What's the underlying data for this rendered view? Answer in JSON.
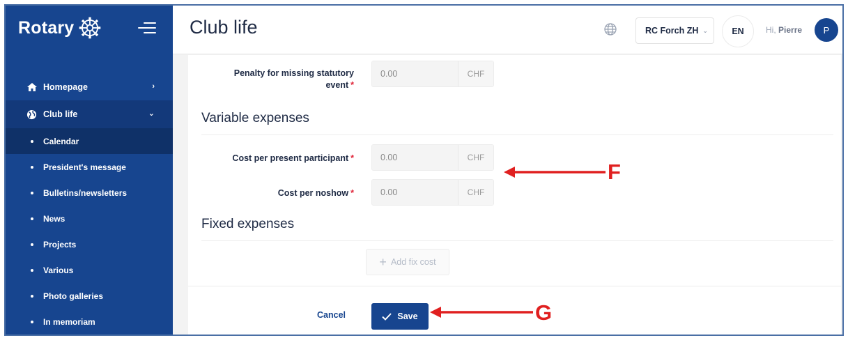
{
  "brand": {
    "name": "Rotary"
  },
  "sidebar": {
    "items": [
      {
        "label": "Homepage",
        "icon": "home-icon"
      },
      {
        "label": "Club life",
        "icon": "globe-icon"
      }
    ],
    "subitems": [
      {
        "label": "Calendar",
        "active": true
      },
      {
        "label": "President's message"
      },
      {
        "label": "Bulletins/newsletters"
      },
      {
        "label": "News"
      },
      {
        "label": "Projects"
      },
      {
        "label": "Various"
      },
      {
        "label": "Photo galleries"
      },
      {
        "label": "In memoriam"
      }
    ]
  },
  "header": {
    "title": "Club life",
    "club_selected": "RC Forch ZH",
    "language": "EN",
    "greeting_prefix": "Hi,",
    "user_name": "Pierre",
    "avatar_initial": "P"
  },
  "form": {
    "penalty": {
      "label_line1": "Penalty for missing statutory",
      "label_line2": "event",
      "value": "0.00",
      "unit": "CHF"
    },
    "variable_title": "Variable expenses",
    "cost_present": {
      "label": "Cost per present participant",
      "value": "0.00",
      "unit": "CHF"
    },
    "cost_noshow": {
      "label": "Cost per noshow",
      "value": "0.00",
      "unit": "CHF"
    },
    "fixed_title": "Fixed expenses",
    "add_fix_cost": "Add fix cost",
    "cancel": "Cancel",
    "save": "Save",
    "required_mark": "*"
  },
  "annotations": {
    "f": "F",
    "g": "G"
  },
  "colors": {
    "brand_blue": "#17458f",
    "required_red": "#e0263a",
    "annotation_red": "#e02020"
  }
}
